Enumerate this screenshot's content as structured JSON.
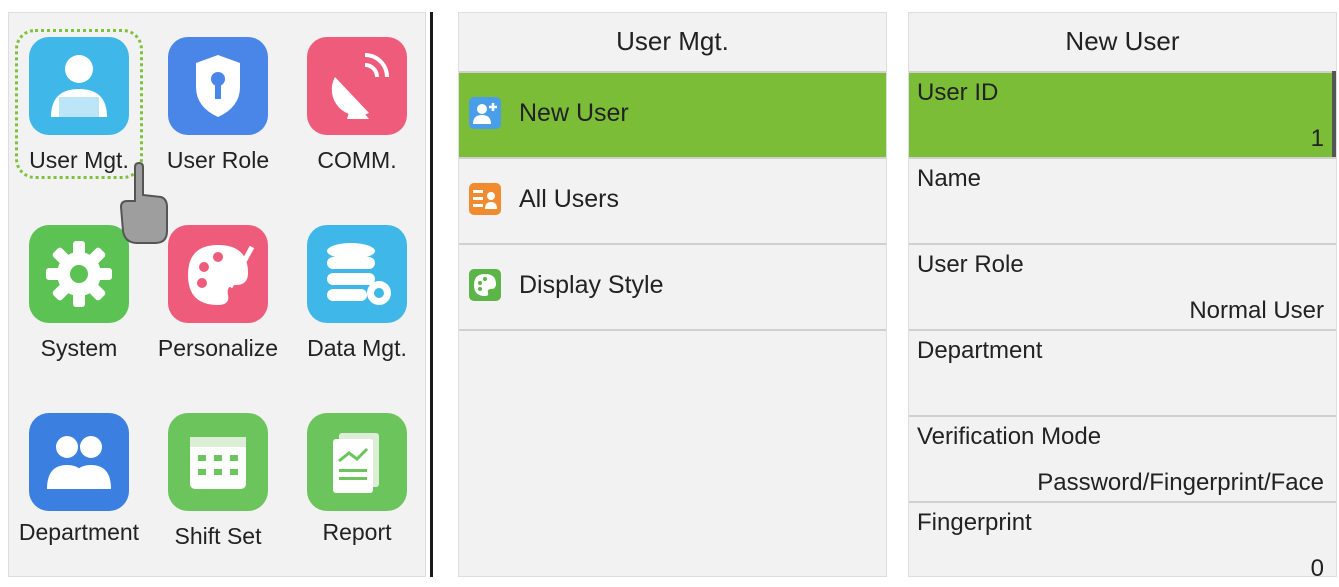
{
  "main_menu": {
    "items": [
      {
        "label": "User Mgt.",
        "icon": "user-mgt-icon",
        "color": "#3fb7e8"
      },
      {
        "label": "User Role",
        "icon": "shield-key-icon",
        "color": "#4a86e8"
      },
      {
        "label": "COMM.",
        "icon": "satellite-dish-icon",
        "color": "#ef5b7a"
      },
      {
        "label": "System",
        "icon": "gear-icon",
        "color": "#5cc254"
      },
      {
        "label": "Personalize",
        "icon": "palette-icon",
        "color": "#ef5b7a"
      },
      {
        "label": "Data Mgt.",
        "icon": "database-gear-icon",
        "color": "#3fb7e8"
      },
      {
        "label": "Department",
        "icon": "people-icon",
        "color": "#3b7fe0"
      },
      {
        "label": "Shift Set",
        "icon": "calendar-icon",
        "color": "#6cc45c"
      },
      {
        "label": "Report",
        "icon": "report-icon",
        "color": "#6cc45c"
      }
    ]
  },
  "user_mgt": {
    "title": "User Mgt.",
    "items": [
      {
        "label": "New User",
        "icon": "add-user-icon",
        "color": "#4a9de8"
      },
      {
        "label": "All Users",
        "icon": "user-list-icon",
        "color": "#f08b30"
      },
      {
        "label": "Display Style",
        "icon": "palette-icon",
        "color": "#5cb548"
      }
    ]
  },
  "new_user": {
    "title": "New User",
    "fields": [
      {
        "label": "User ID",
        "value": "1"
      },
      {
        "label": "Name",
        "value": ""
      },
      {
        "label": "User Role",
        "value": "Normal User"
      },
      {
        "label": "Department",
        "value": ""
      },
      {
        "label": "Verification Mode",
        "value": "Password/Fingerprint/Face"
      },
      {
        "label": "Fingerprint",
        "value": "0"
      }
    ]
  },
  "colors": {
    "highlight": "#7cbd38"
  }
}
